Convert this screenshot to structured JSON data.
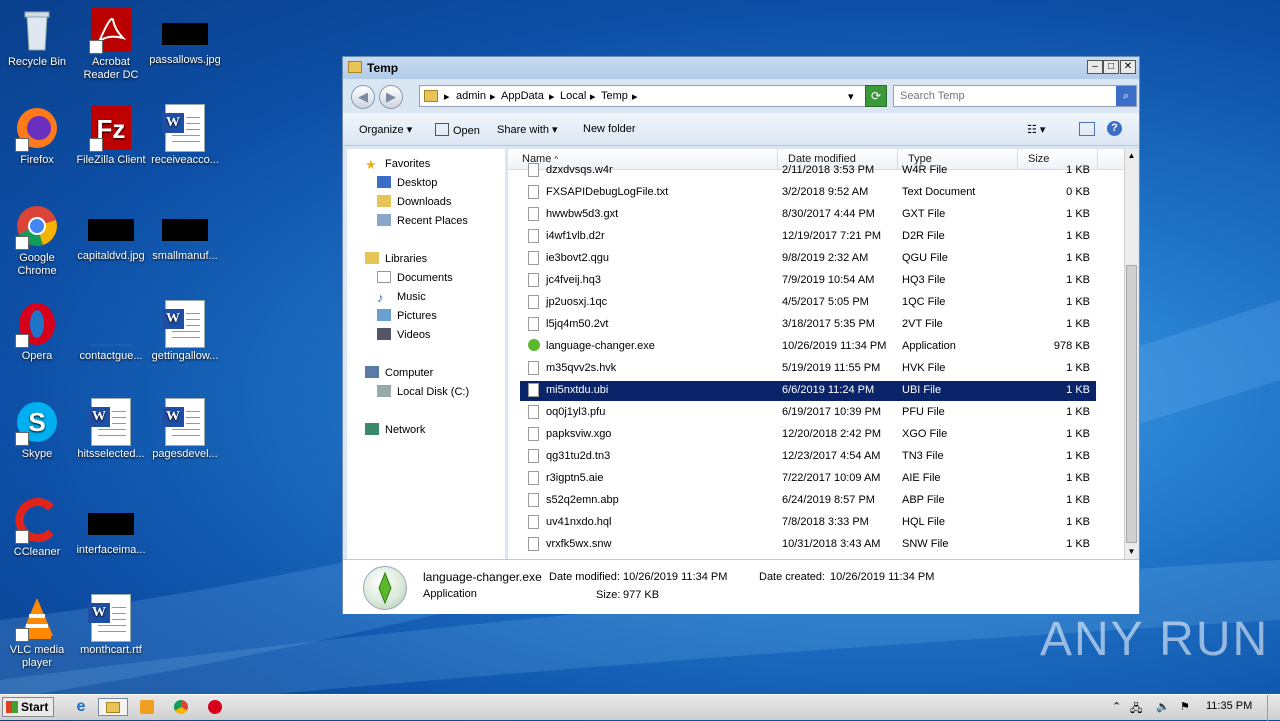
{
  "desktop": {
    "icons": [
      {
        "label": "Recycle Bin"
      },
      {
        "label": "Acrobat Reader DC"
      },
      {
        "label": "passallows.jpg"
      },
      {
        "label": "Firefox"
      },
      {
        "label": "FileZilla Client"
      },
      {
        "label": "receiveacco..."
      },
      {
        "label": "Google Chrome"
      },
      {
        "label": "capitaldvd.jpg"
      },
      {
        "label": "smallmanuf..."
      },
      {
        "label": "Opera"
      },
      {
        "label": "contactgue..."
      },
      {
        "label": "gettingallow..."
      },
      {
        "label": "Skype"
      },
      {
        "label": "hitsselected..."
      },
      {
        "label": "pagesdevel..."
      },
      {
        "label": "CCleaner"
      },
      {
        "label": "interfaceima..."
      },
      {
        "label": "VLC media player"
      },
      {
        "label": "monthcart.rtf"
      }
    ]
  },
  "window": {
    "title": "Temp",
    "breadcrumb": [
      "admin",
      "AppData",
      "Local",
      "Temp"
    ],
    "search_placeholder": "Search Temp",
    "toolbar": {
      "organize": "Organize",
      "open": "Open",
      "share_with": "Share with",
      "new_folder": "New folder"
    },
    "nav": {
      "favorites": "Favorites",
      "desktop": "Desktop",
      "downloads": "Downloads",
      "recent": "Recent Places",
      "libraries": "Libraries",
      "documents": "Documents",
      "music": "Music",
      "pictures": "Pictures",
      "videos": "Videos",
      "computer": "Computer",
      "local_disk": "Local Disk (C:)",
      "network": "Network"
    },
    "columns": {
      "name": "Name",
      "date": "Date modified",
      "type": "Type",
      "size": "Size"
    },
    "files": [
      {
        "name": "dzxdvsqs.w4r",
        "date": "2/11/2018 3:53 PM",
        "type": "W4R File",
        "size": "1 KB"
      },
      {
        "name": "FXSAPIDebugLogFile.txt",
        "date": "3/2/2018 9:52 AM",
        "type": "Text Document",
        "size": "0 KB"
      },
      {
        "name": "hwwbw5d3.gxt",
        "date": "8/30/2017 4:44 PM",
        "type": "GXT File",
        "size": "1 KB"
      },
      {
        "name": "i4wf1vlb.d2r",
        "date": "12/19/2017 7:21 PM",
        "type": "D2R File",
        "size": "1 KB"
      },
      {
        "name": "ie3bovt2.qgu",
        "date": "9/8/2019 2:32 AM",
        "type": "QGU File",
        "size": "1 KB"
      },
      {
        "name": "jc4fveij.hq3",
        "date": "7/9/2019 10:54 AM",
        "type": "HQ3 File",
        "size": "1 KB"
      },
      {
        "name": "jp2uosxj.1qc",
        "date": "4/5/2017 5:05 PM",
        "type": "1QC File",
        "size": "1 KB"
      },
      {
        "name": "l5jq4m50.2vt",
        "date": "3/18/2017 5:35 PM",
        "type": "2VT File",
        "size": "1 KB"
      },
      {
        "name": "language-changer.exe",
        "date": "10/26/2019 11:34 PM",
        "type": "Application",
        "size": "978 KB"
      },
      {
        "name": "m35qvv2s.hvk",
        "date": "5/19/2019 11:55 PM",
        "type": "HVK File",
        "size": "1 KB"
      },
      {
        "name": "mi5nxtdu.ubi",
        "date": "6/6/2019 11:24 PM",
        "type": "UBI File",
        "size": "1 KB"
      },
      {
        "name": "oq0j1yl3.pfu",
        "date": "6/19/2017 10:39 PM",
        "type": "PFU File",
        "size": "1 KB"
      },
      {
        "name": "papksviw.xgo",
        "date": "12/20/2018 2:42 PM",
        "type": "XGO File",
        "size": "1 KB"
      },
      {
        "name": "qg31tu2d.tn3",
        "date": "12/23/2017 4:54 AM",
        "type": "TN3 File",
        "size": "1 KB"
      },
      {
        "name": "r3igptn5.aie",
        "date": "7/22/2017 10:09 AM",
        "type": "AIE File",
        "size": "1 KB"
      },
      {
        "name": "s52q2emn.abp",
        "date": "6/24/2019 8:57 PM",
        "type": "ABP File",
        "size": "1 KB"
      },
      {
        "name": "uv41nxdo.hql",
        "date": "7/8/2018 3:33 PM",
        "type": "HQL File",
        "size": "1 KB"
      },
      {
        "name": "vrxfk5wx.snw",
        "date": "10/31/2018 3:43 AM",
        "type": "SNW File",
        "size": "1 KB"
      }
    ],
    "selected_index": 10,
    "details": {
      "name": "language-changer.exe",
      "type": "Application",
      "date_modified_label": "Date modified:",
      "date_modified": "10/26/2019 11:34 PM",
      "date_created_label": "Date created:",
      "date_created": "10/26/2019 11:34 PM",
      "size_label": "Size:",
      "size": "977 KB"
    }
  },
  "taskbar": {
    "start_label": "Start",
    "clock": "11:35 PM"
  },
  "watermark": "ANY RUN",
  "colors": {
    "selection": "#0a246a",
    "desktop": "#1f74c8"
  }
}
